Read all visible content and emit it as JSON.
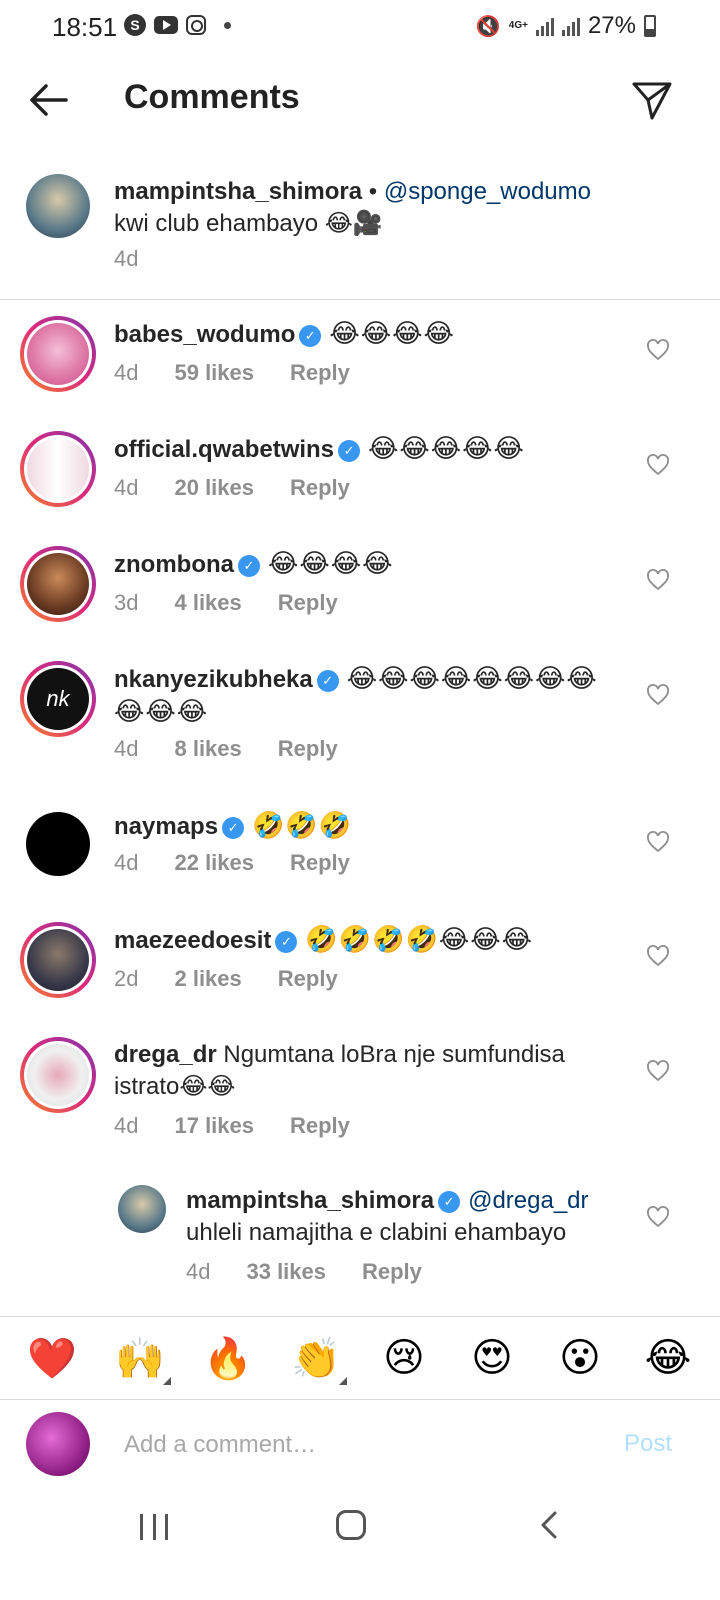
{
  "status": {
    "time": "18:51",
    "network": "4G+",
    "battery": "27%"
  },
  "header": {
    "title": "Comments"
  },
  "caption": {
    "username": "mampintsha_shimora",
    "mention": "@sponge_wodumo",
    "text": "kwi club ehambayo 😂🎥",
    "age": "4d"
  },
  "comments": [
    {
      "username": "babes_wodumo",
      "verified": true,
      "text": "😂😂😂😂",
      "age": "4d",
      "likes": "59 likes",
      "reply": "Reply"
    },
    {
      "username": "official.qwabetwins",
      "verified": true,
      "text": "😂😂😂😂😂",
      "age": "4d",
      "likes": "20 likes",
      "reply": "Reply"
    },
    {
      "username": "znombona",
      "verified": true,
      "text": "😂😂😂😂",
      "age": "3d",
      "likes": "4 likes",
      "reply": "Reply"
    },
    {
      "username": "nkanyezikubheka",
      "verified": true,
      "text": "😂😂😂😂😂😂😂😂",
      "text2": "😂😂😂",
      "age": "4d",
      "likes": "8 likes",
      "reply": "Reply"
    },
    {
      "username": "naymaps",
      "verified": true,
      "text": "🤣🤣🤣",
      "age": "4d",
      "likes": "22 likes",
      "reply": "Reply"
    },
    {
      "username": "maezeedoesit",
      "verified": true,
      "text": "🤣🤣🤣🤣😂😂😂",
      "age": "2d",
      "likes": "2 likes",
      "reply": "Reply"
    },
    {
      "username": "drega_dr",
      "verified": false,
      "text": "Ngumtana loBra nje sumfundisa",
      "text2": "istrato😂😂",
      "age": "4d",
      "likes": "17 likes",
      "reply": "Reply"
    }
  ],
  "reply": {
    "username": "mampintsha_shimora",
    "verified": true,
    "mention": "@drega_dr",
    "text": "uhleli namajitha e clabini ehambayo",
    "age": "4d",
    "likes": "33 likes",
    "reply": "Reply"
  },
  "reactions": [
    "❤️",
    "🙌",
    "🔥",
    "👏",
    "😢",
    "😍",
    "😮",
    "😂"
  ],
  "input": {
    "placeholder": "Add a comment…",
    "post_label": "Post"
  },
  "colors": {
    "verified": "#3897f0",
    "mention": "#00376b",
    "post_disabled": "#b2dffc"
  }
}
